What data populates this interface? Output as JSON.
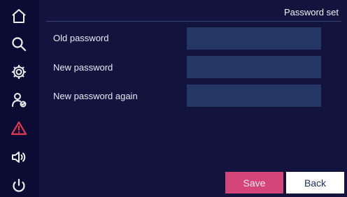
{
  "title": "Password set",
  "sidebar": {
    "items": [
      {
        "icon": "home-icon"
      },
      {
        "icon": "search-icon"
      },
      {
        "icon": "gear-icon"
      },
      {
        "icon": "user-check-icon"
      },
      {
        "icon": "warning-icon",
        "color": "#e8384f"
      },
      {
        "icon": "speaker-icon"
      },
      {
        "icon": "power-icon"
      }
    ]
  },
  "form": {
    "fields": [
      {
        "label": "Old password",
        "value": ""
      },
      {
        "label": "New password",
        "value": ""
      },
      {
        "label": "New password again",
        "value": ""
      }
    ]
  },
  "buttons": {
    "save_label": "Save",
    "back_label": "Back"
  },
  "colors": {
    "background": "#12143e",
    "sidebar": "#0a0c33",
    "input": "#253765",
    "save": "#d4467a",
    "back": "#ffffff",
    "warning": "#e8384f"
  }
}
